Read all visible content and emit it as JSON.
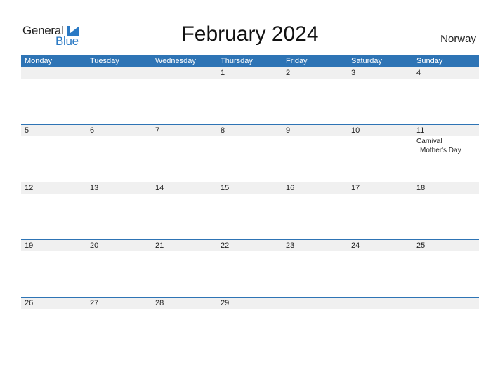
{
  "logo": {
    "line1": "General",
    "line2": "Blue"
  },
  "title": "February 2024",
  "country": "Norway",
  "colors": {
    "header_bg": "#2e74b5",
    "daybar_bg": "#f0f0f0",
    "logo_blue": "#2a79c4"
  },
  "weekdays": [
    "Monday",
    "Tuesday",
    "Wednesday",
    "Thursday",
    "Friday",
    "Saturday",
    "Sunday"
  ],
  "weeks": [
    {
      "days": [
        "",
        "",
        "",
        "1",
        "2",
        "3",
        "4"
      ],
      "holidays": [
        [],
        [],
        [],
        [],
        [],
        [],
        []
      ]
    },
    {
      "days": [
        "5",
        "6",
        "7",
        "8",
        "9",
        "10",
        "11"
      ],
      "holidays": [
        [],
        [],
        [],
        [],
        [],
        [],
        [
          "Carnival",
          "Mother's Day"
        ]
      ]
    },
    {
      "days": [
        "12",
        "13",
        "14",
        "15",
        "16",
        "17",
        "18"
      ],
      "holidays": [
        [],
        [],
        [],
        [],
        [],
        [],
        []
      ]
    },
    {
      "days": [
        "19",
        "20",
        "21",
        "22",
        "23",
        "24",
        "25"
      ],
      "holidays": [
        [],
        [],
        [],
        [],
        [],
        [],
        []
      ]
    },
    {
      "days": [
        "26",
        "27",
        "28",
        "29",
        "",
        "",
        ""
      ],
      "holidays": [
        [],
        [],
        [],
        [],
        [],
        [],
        []
      ]
    }
  ]
}
